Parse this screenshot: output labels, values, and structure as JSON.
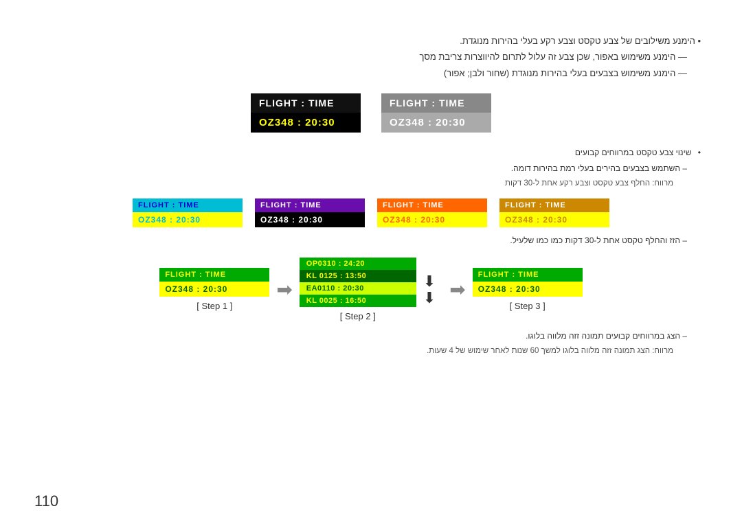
{
  "page": {
    "number": "110",
    "topbar_color": "#333"
  },
  "section1": {
    "bullet1": "הימנע משילובים של צבע טקסט וצבע רקע בעלי בהירות מנוגדת.",
    "dash1": "הימנע משימוש באפור, שכן צבע זה עלול לתרום להיווצרות צריבת מסך",
    "dash2": "הימנע משימוש בצבעים בעלי בהירות מנוגדת (שחור ולבן; אפור)"
  },
  "widgets_top": [
    {
      "id": "w1",
      "variant": "black-yellow",
      "header": "FLIGHT  :  TIME",
      "body": "OZ348  :  20:30"
    },
    {
      "id": "w2",
      "variant": "gray-gray",
      "header": "FLIGHT  :  TIME",
      "body": "OZ348  :  20:30"
    }
  ],
  "section2": {
    "bullet1": "שינוי צבע טקסט במרווחים קבועים",
    "dash1": "השתמש בצבעים בהירים בעלי רמת בהירות דומה.",
    "sub1": "מרווח: החלף צבע טקסט וצבע רקע אחת ל-30 דקות"
  },
  "widgets_four": [
    {
      "id": "w3",
      "variant": "cyan",
      "header": "FLIGHT  :  TIME",
      "body": "OZ348  :  20:30"
    },
    {
      "id": "w4",
      "variant": "purple",
      "header": "FLIGHT  :  TIME",
      "body": "OZ348  :  20:30"
    },
    {
      "id": "w5",
      "variant": "orange",
      "header": "FLIGHT  :  TIME",
      "body": "OZ348  :  20:30"
    },
    {
      "id": "w6",
      "variant": "olive",
      "header": "FLIGHT  :  TIME",
      "body": "OZ348  :  20:30"
    }
  ],
  "section3": {
    "dash1": "הזז והחלף טקסט אחת ל-30 דקות כמו כמו שלעיל."
  },
  "steps": {
    "step1_label": "[ Step 1 ]",
    "step2_label": "[ Step 2 ]",
    "step3_label": "[ Step 3 ]",
    "step1_widget": {
      "variant": "green",
      "header": "FLIGHT  :  TIME",
      "body": "OZ348  :  20:30"
    },
    "step2_rows": [
      {
        "text": "OP0310  :  24:20",
        "bg": "bg-green"
      },
      {
        "text": "KL 0125  :  13:50",
        "bg": "bg-darkgreen"
      },
      {
        "text": "EA0110  :  20:30",
        "bg": "bg-yellow-green"
      },
      {
        "text": "KL 0025  :  16:50",
        "bg": "bg-green"
      }
    ],
    "step3_widget": {
      "variant": "green",
      "header": "FLIGHT  :  TIME",
      "body": "OZ348  :  20:30"
    }
  },
  "section4": {
    "dash1": "הצג במרווחים קבועים תמונה זזה מלווה בלוגו.",
    "sub1": "מרווח: הצג תמונה זזה מלווה בלוגו למשך 60 שנות לאחר שימוש של 4 שעות."
  }
}
